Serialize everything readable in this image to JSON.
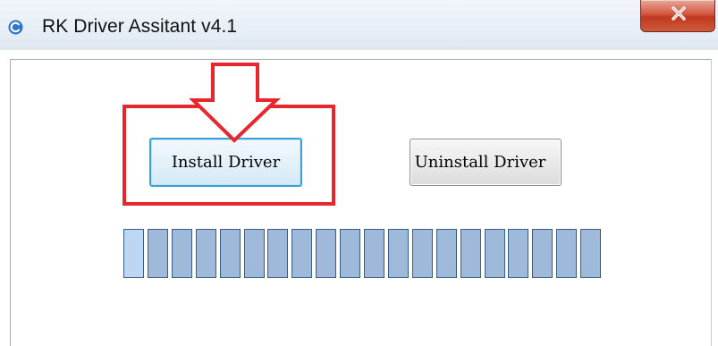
{
  "window": {
    "title": "RK Driver Assitant v4.1",
    "icon": "rk-logo-icon",
    "close_icon": "close-x-icon"
  },
  "buttons": {
    "install_label": "Install Driver",
    "uninstall_label": "Uninstall Driver"
  },
  "progress": {
    "segment_count": 20,
    "highlighted_segments": 1,
    "segment_color": "#9eb9d9",
    "highlight_color": "#bdd7f3"
  },
  "annotation": {
    "color": "#e8262d",
    "shape": "rectangle-with-down-arrow",
    "target": "install-driver-button"
  }
}
